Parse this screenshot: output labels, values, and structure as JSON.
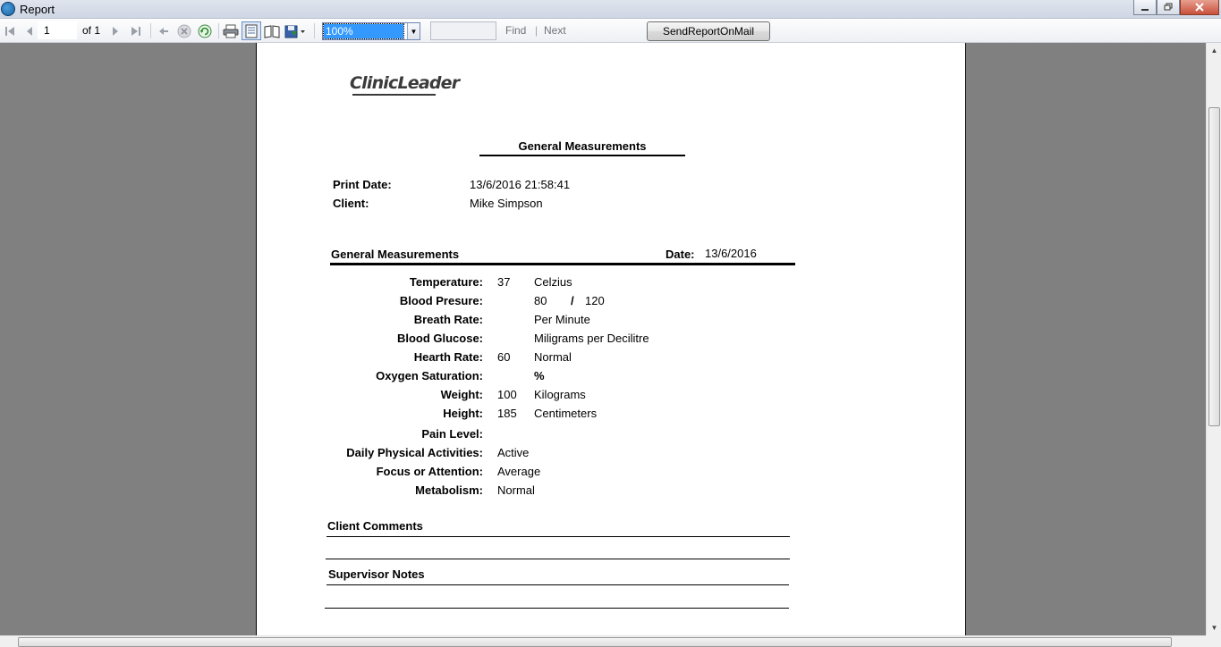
{
  "window": {
    "title": "Report"
  },
  "toolbar": {
    "page_number": "1",
    "page_of": "of 1",
    "zoom_value": "100%",
    "find_placeholder": "",
    "find_label": "Find",
    "find_separator": "|",
    "next_label": "Next",
    "send_label": "SendReportOnMail"
  },
  "report": {
    "logo_text": "ClinicLeader",
    "title": "General Measurements",
    "print_date_label": "Print Date:",
    "print_date_value": "13/6/2016 21:58:41",
    "client_label": "Client:",
    "client_value": "Mike Simpson",
    "section_title": "General Measurements",
    "date_label": "Date:",
    "date_value": "13/6/2016",
    "measurements": [
      {
        "label": "Temperature:",
        "value": "37",
        "unit": "Celzius"
      },
      {
        "label": "Blood Presure:",
        "value": "",
        "unit": "80",
        "slash": "/",
        "unit2": "120"
      },
      {
        "label": "Breath Rate:",
        "value": "",
        "unit": "Per Minute"
      },
      {
        "label": "Blood Glucose:",
        "value": "",
        "unit": "Miligrams per Decilitre"
      },
      {
        "label": "Hearth Rate:",
        "value": "60",
        "unit": "Normal"
      },
      {
        "label": "Oxygen Saturation:",
        "value": "",
        "unit": "%"
      },
      {
        "label": "Weight:",
        "value": "100",
        "unit": "Kilograms"
      },
      {
        "label": "Height:",
        "value": "185",
        "unit": "Centimeters"
      },
      {
        "label": "Pain Level:",
        "value": "",
        "unit": ""
      },
      {
        "label": "Daily Physical Activities:",
        "value": "Active",
        "unit": ""
      },
      {
        "label": "Focus or Attention:",
        "value": "Average",
        "unit": ""
      },
      {
        "label": "Metabolism:",
        "value": "Normal",
        "unit": ""
      }
    ],
    "client_comments_label": "Client Comments",
    "supervisor_notes_label": "Supervisor Notes"
  }
}
